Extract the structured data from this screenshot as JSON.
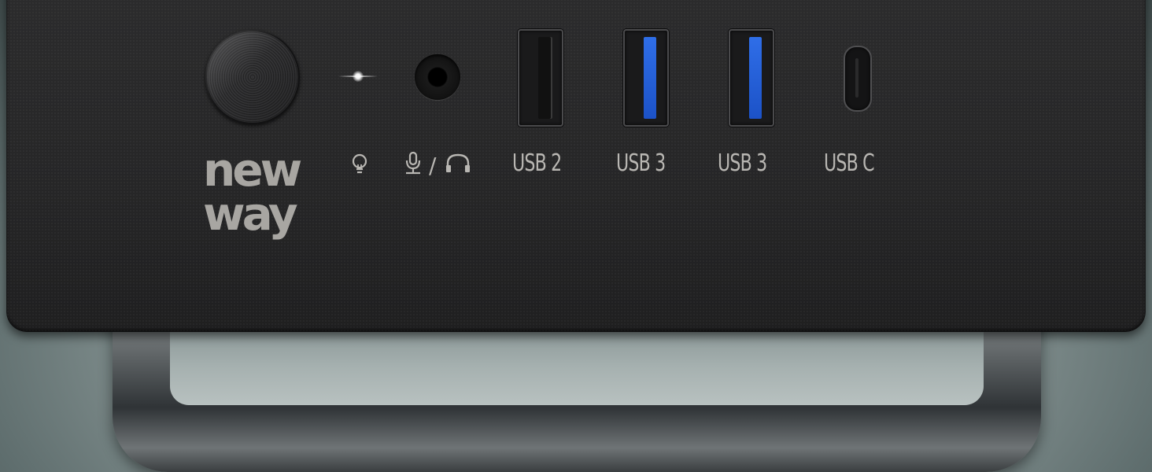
{
  "logo": {
    "line1": "new",
    "line2": "way"
  },
  "ports": [
    {
      "label": "USB 2",
      "type": "usb-a",
      "color": "#111111"
    },
    {
      "label": "USB 3",
      "type": "usb-a",
      "color": "#2f6ee8"
    },
    {
      "label": "USB 3",
      "type": "usb-a",
      "color": "#2f6ee8"
    },
    {
      "label": "USB C",
      "type": "usb-c",
      "color": "#141415"
    }
  ],
  "icons": {
    "led": "lightbulb-icon",
    "audio": "microphone-headphones-icon",
    "separator": "/"
  },
  "colors": {
    "case": "#262627",
    "label": "#b9b7b3",
    "usb3_accent": "#2f6ee8"
  }
}
